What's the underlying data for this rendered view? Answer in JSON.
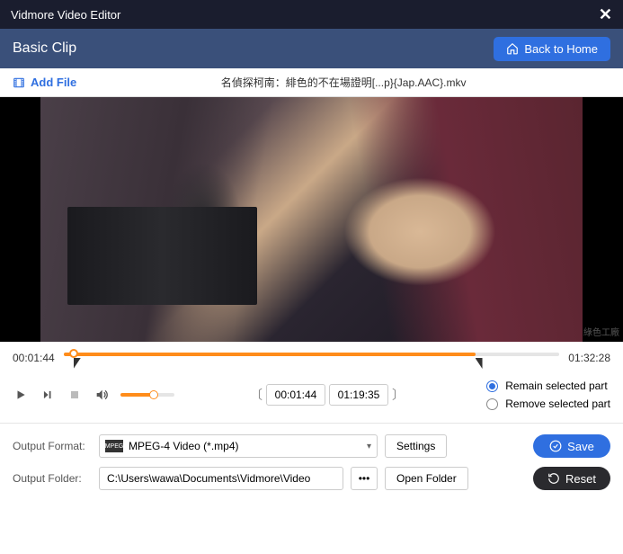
{
  "titlebar": {
    "app_name": "Vidmore Video Editor"
  },
  "header": {
    "title": "Basic Clip",
    "back_label": "Back to Home"
  },
  "toolbar": {
    "add_file_label": "Add File",
    "filename": "名偵探柯南：緋色的不在場證明[...p}{Jap.AAC}.mkv"
  },
  "timeline": {
    "current_time": "00:01:44",
    "total_time": "01:32:28",
    "sel_start": "00:01:44",
    "sel_end": "01:19:35",
    "progress_pct": 83,
    "bracket_left_pct": 2,
    "bracket_right_pct": 83
  },
  "options": {
    "remain_label": "Remain selected part",
    "remove_label": "Remove selected part",
    "selected": "remain"
  },
  "output": {
    "format_label": "Output Format:",
    "format_value": "MPEG-4 Video (*.mp4)",
    "format_icon_text": "MPEG",
    "settings_label": "Settings",
    "save_label": "Save",
    "folder_label": "Output Folder:",
    "folder_value": "C:\\Users\\wawa\\Documents\\Vidmore\\Video",
    "open_folder_label": "Open Folder",
    "reset_label": "Reset"
  },
  "watermark": "綠色工廠"
}
